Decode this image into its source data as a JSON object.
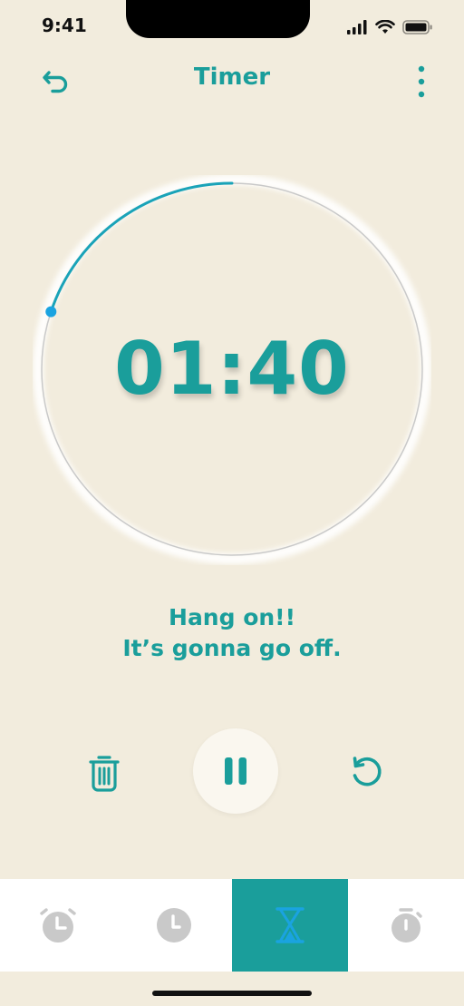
{
  "status_bar": {
    "time": "9:41"
  },
  "header": {
    "title": "Timer",
    "back_icon": "undo-arrow-icon",
    "menu_icon": "more-vertical-icon"
  },
  "timer": {
    "display": "01:40",
    "elapsed_fraction": 0.2
  },
  "message": {
    "line1": "Hang on!!",
    "line2": "It’s gonna go off."
  },
  "controls": {
    "delete_icon": "trash-icon",
    "pause_icon": "pause-icon",
    "reset_icon": "reset-icon"
  },
  "tabs": [
    {
      "name": "alarm",
      "icon": "alarm-clock-icon",
      "active": false
    },
    {
      "name": "clock",
      "icon": "clock-icon",
      "active": false
    },
    {
      "name": "timer",
      "icon": "hourglass-icon",
      "active": true
    },
    {
      "name": "stopwatch",
      "icon": "stopwatch-icon",
      "active": false
    }
  ],
  "colors": {
    "accent": "#1A9E9B",
    "background": "#F2ECDD",
    "progress": "#1AA3B8",
    "inactive_icon": "#C9C9C9"
  }
}
